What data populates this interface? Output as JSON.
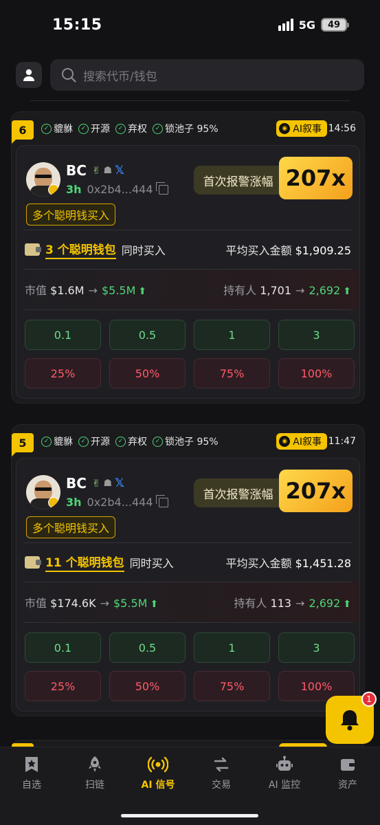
{
  "status": {
    "time": "15:15",
    "network": "5G",
    "battery": "49"
  },
  "search": {
    "placeholder": "搜索代币/钱包"
  },
  "cards": [
    {
      "rank": "6",
      "tags": [
        "貔貅",
        "开源",
        "弃权",
        "锁池子 95%"
      ],
      "ai_label": "AI叙事",
      "time": "14:56",
      "token": {
        "name": "BC",
        "age": "3h",
        "address": "0x2b4...444"
      },
      "smart_tag": "多个聪明钱买入",
      "alert_label": "首次报警涨幅",
      "alert_multiplier": "207x",
      "wallet_count": "3 个聪明钱包",
      "wallet_suffix": "同时买入",
      "avg_buy_label": "平均买入金额",
      "avg_buy_value": "$1,909.25",
      "mc_label": "市值",
      "mc_from": "$1.6M",
      "mc_to": "$5.5M",
      "holders_label": "持有人",
      "holders_from": "1,701",
      "holders_to": "2,692",
      "buy_amounts": [
        "0.1",
        "0.5",
        "1",
        "3"
      ],
      "sell_percents": [
        "25%",
        "50%",
        "75%",
        "100%"
      ]
    },
    {
      "rank": "5",
      "tags": [
        "貔貅",
        "开源",
        "弃权",
        "锁池子 95%"
      ],
      "ai_label": "AI叙事",
      "time": "11:47",
      "token": {
        "name": "BC",
        "age": "3h",
        "address": "0x2b4...444"
      },
      "smart_tag": "多个聪明钱买入",
      "alert_label": "首次报警涨幅",
      "alert_multiplier": "207x",
      "wallet_count": "11 个聪明钱包",
      "wallet_suffix": "同时买入",
      "avg_buy_label": "平均买入金额",
      "avg_buy_value": "$1,451.28",
      "mc_label": "市值",
      "mc_from": "$174.6K",
      "mc_to": "$5.5M",
      "holders_label": "持有人",
      "holders_from": "113",
      "holders_to": "2,692",
      "buy_amounts": [
        "0.1",
        "0.5",
        "1",
        "3"
      ],
      "sell_percents": [
        "25%",
        "50%",
        "75%",
        "100%"
      ]
    }
  ],
  "notification_count": "1",
  "tabs": [
    {
      "label": "自选",
      "icon": "star-bookmark-icon"
    },
    {
      "label": "扫链",
      "icon": "rocket-icon"
    },
    {
      "label": "AI 信号",
      "icon": "signal-broadcast-icon"
    },
    {
      "label": "交易",
      "icon": "swap-arrows-icon"
    },
    {
      "label": "AI 监控",
      "icon": "robot-icon"
    },
    {
      "label": "资产",
      "icon": "wallet-icon"
    }
  ],
  "colors": {
    "accent": "#f5c400",
    "buy": "#6fdc8c",
    "sell": "#ff5a6b",
    "positive": "#4fd676"
  }
}
